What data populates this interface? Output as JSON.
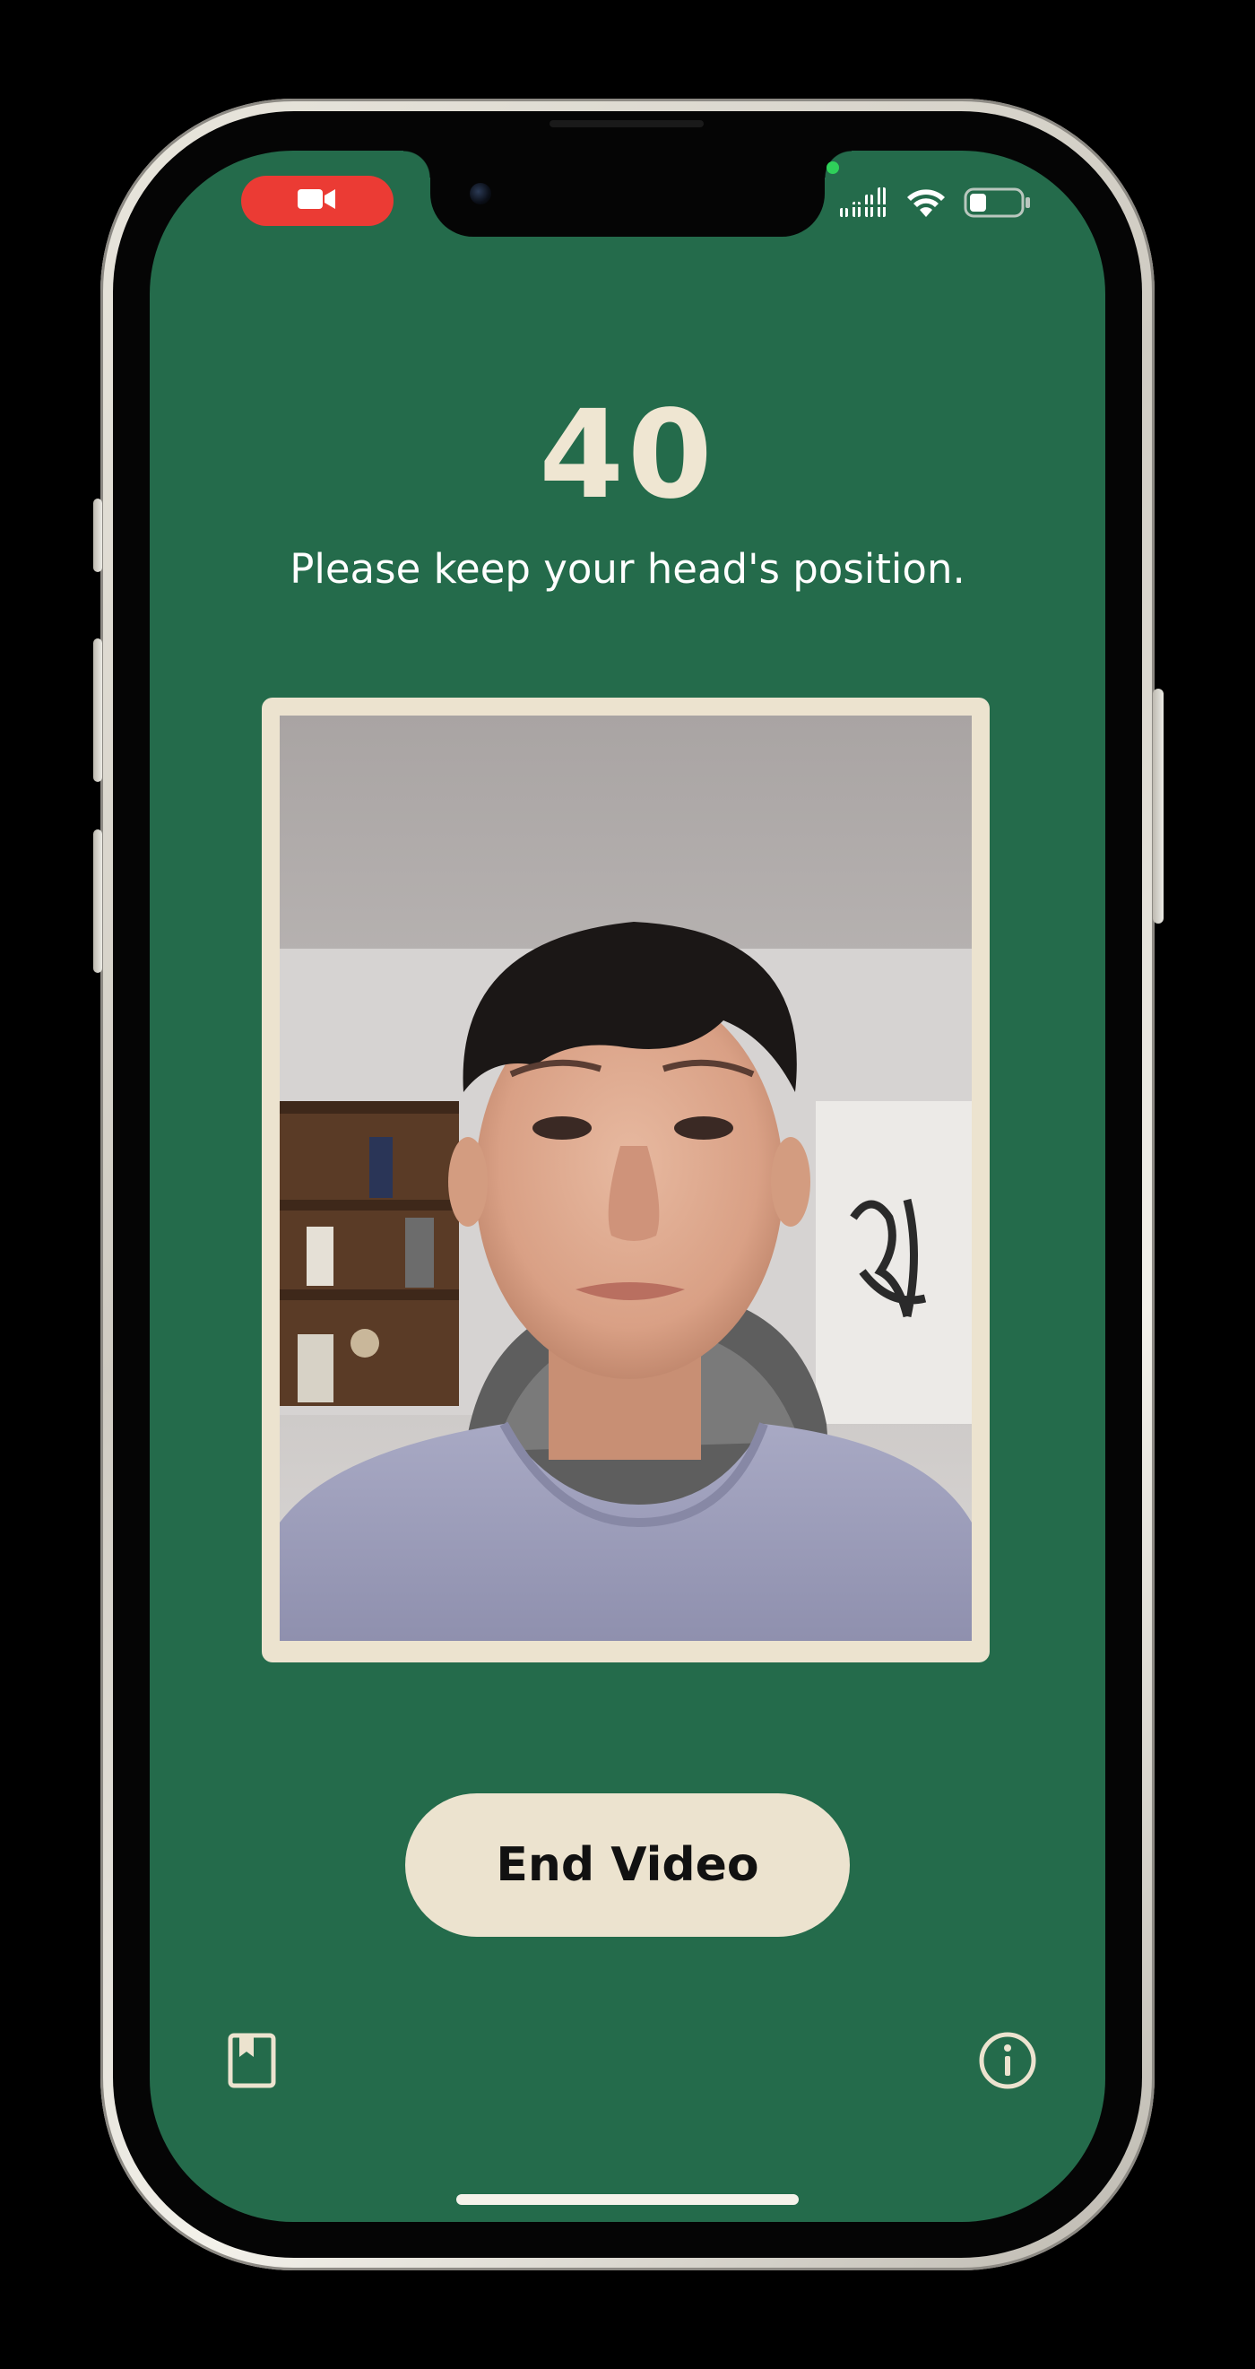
{
  "theme": {
    "background": "#246b4b",
    "accent_cream": "#ece3cf",
    "text_cream": "#efe6d2",
    "record_red": "#eb3b34",
    "privacy_green": "#2fd15a"
  },
  "status_bar": {
    "recording_icon": "video-camera-icon",
    "signal_icon": "cellular-signal-icon",
    "wifi_icon": "wifi-icon",
    "battery_icon": "battery-icon"
  },
  "timer": {
    "value": "40"
  },
  "instruction": {
    "text": "Please keep your head's position."
  },
  "video": {
    "feed_icon": "live-camera-feed"
  },
  "actions": {
    "end_video_label": "End Video"
  },
  "bottom_bar": {
    "left_icon": "bookmark-icon",
    "right_icon": "info-icon"
  }
}
